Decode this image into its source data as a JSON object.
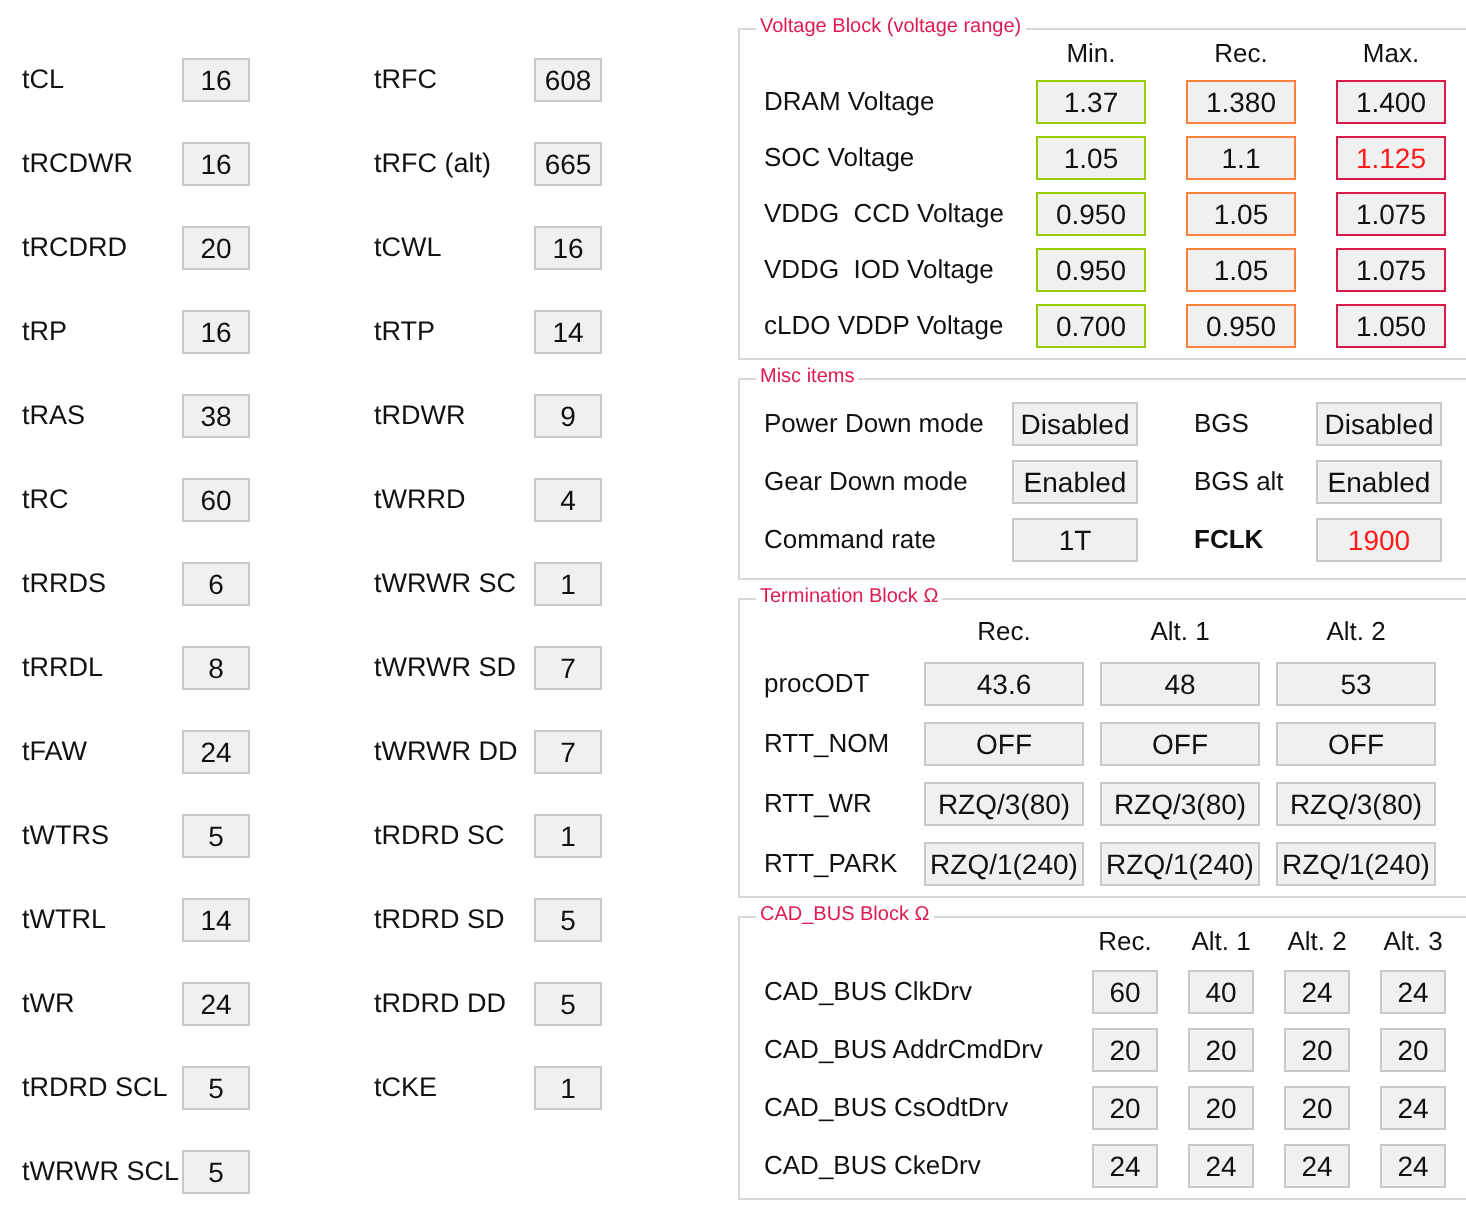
{
  "timings_left": [
    {
      "label": "tCL",
      "value": "16"
    },
    {
      "label": "tRCDWR",
      "value": "16"
    },
    {
      "label": "tRCDRD",
      "value": "20"
    },
    {
      "label": "tRP",
      "value": "16"
    },
    {
      "label": "tRAS",
      "value": "38"
    },
    {
      "label": "tRC",
      "value": "60"
    },
    {
      "label": "tRRDS",
      "value": "6"
    },
    {
      "label": "tRRDL",
      "value": "8"
    },
    {
      "label": "tFAW",
      "value": "24"
    },
    {
      "label": "tWTRS",
      "value": "5"
    },
    {
      "label": "tWTRL",
      "value": "14"
    },
    {
      "label": "tWR",
      "value": "24"
    },
    {
      "label": "tRDRD SCL",
      "value": "5"
    },
    {
      "label": "tWRWR SCL",
      "value": "5"
    }
  ],
  "timings_right": [
    {
      "label": "tRFC",
      "value": "608"
    },
    {
      "label": "tRFC (alt)",
      "value": "665"
    },
    {
      "label": "tCWL",
      "value": "16"
    },
    {
      "label": "tRTP",
      "value": "14"
    },
    {
      "label": "tRDWR",
      "value": "9"
    },
    {
      "label": "tWRRD",
      "value": "4"
    },
    {
      "label": "tWRWR SC",
      "value": "1"
    },
    {
      "label": "tWRWR SD",
      "value": "7"
    },
    {
      "label": "tWRWR DD",
      "value": "7"
    },
    {
      "label": "tRDRD SC",
      "value": "1"
    },
    {
      "label": "tRDRD SD",
      "value": "5"
    },
    {
      "label": "tRDRD DD",
      "value": "5"
    },
    {
      "label": "tCKE",
      "value": "1"
    }
  ],
  "voltage_block": {
    "title": "Voltage Block (voltage range)",
    "columns": [
      {
        "label": "Min.",
        "color": "#99cc00"
      },
      {
        "label": "Rec.",
        "color": "#ff7f3f"
      },
      {
        "label": "Max.",
        "color": "#d81b4a"
      }
    ],
    "rows": [
      {
        "label": "DRAM Voltage",
        "values": [
          {
            "text": "1.37",
            "alert": false
          },
          {
            "text": "1.380",
            "alert": false
          },
          {
            "text": "1.400",
            "alert": false
          }
        ]
      },
      {
        "label": "SOC Voltage",
        "values": [
          {
            "text": "1.05",
            "alert": false
          },
          {
            "text": "1.1",
            "alert": false
          },
          {
            "text": "1.125",
            "alert": true
          }
        ]
      },
      {
        "label": "VDDG  CCD Voltage",
        "values": [
          {
            "text": "0.950",
            "alert": false
          },
          {
            "text": "1.05",
            "alert": false
          },
          {
            "text": "1.075",
            "alert": false
          }
        ]
      },
      {
        "label": "VDDG  IOD Voltage",
        "values": [
          {
            "text": "0.950",
            "alert": false
          },
          {
            "text": "1.05",
            "alert": false
          },
          {
            "text": "1.075",
            "alert": false
          }
        ]
      },
      {
        "label": "cLDO VDDP Voltage",
        "values": [
          {
            "text": "0.700",
            "alert": false
          },
          {
            "text": "0.950",
            "alert": false
          },
          {
            "text": "1.050",
            "alert": false
          }
        ]
      }
    ]
  },
  "misc_items": {
    "title": "Misc items",
    "rows": [
      [
        {
          "label": "Power Down mode",
          "bold": false,
          "value": "Disabled",
          "alert": false
        },
        {
          "label": "BGS",
          "bold": false,
          "value": "Disabled",
          "alert": false
        }
      ],
      [
        {
          "label": "Gear Down mode",
          "bold": false,
          "value": "Enabled",
          "alert": false
        },
        {
          "label": "BGS alt",
          "bold": false,
          "value": "Enabled",
          "alert": false
        }
      ],
      [
        {
          "label": "Command rate",
          "bold": false,
          "value": "1T",
          "alert": false
        },
        {
          "label": "FCLK",
          "bold": true,
          "value": "1900",
          "alert": true
        }
      ]
    ]
  },
  "termination_block": {
    "title": "Termination Block Ω",
    "columns": [
      "Rec.",
      "Alt. 1",
      "Alt. 2"
    ],
    "rows": [
      {
        "label": "procODT",
        "values": [
          "43.6",
          "48",
          "53"
        ]
      },
      {
        "label": "RTT_NOM",
        "values": [
          "OFF",
          "OFF",
          "OFF"
        ]
      },
      {
        "label": "RTT_WR",
        "values": [
          "RZQ/3(80)",
          "RZQ/3(80)",
          "RZQ/3(80)"
        ]
      },
      {
        "label": "RTT_PARK",
        "values": [
          "RZQ/1(240)",
          "RZQ/1(240)",
          "RZQ/1(240)"
        ]
      }
    ]
  },
  "cad_bus_block": {
    "title": "CAD_BUS Block Ω",
    "columns": [
      "Rec.",
      "Alt. 1",
      "Alt. 2",
      "Alt. 3"
    ],
    "rows": [
      {
        "label": "CAD_BUS ClkDrv",
        "values": [
          "60",
          "40",
          "24",
          "24"
        ]
      },
      {
        "label": "CAD_BUS AddrCmdDrv",
        "values": [
          "20",
          "20",
          "20",
          "20"
        ]
      },
      {
        "label": "CAD_BUS CsOdtDrv",
        "values": [
          "20",
          "20",
          "20",
          "24"
        ]
      },
      {
        "label": "CAD_BUS CkeDrv",
        "values": [
          "24",
          "24",
          "24",
          "24"
        ]
      }
    ]
  }
}
